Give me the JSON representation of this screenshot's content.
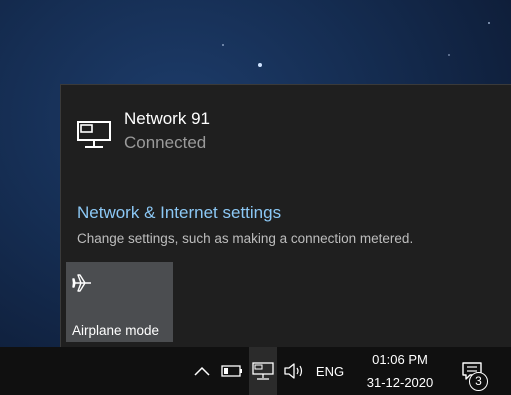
{
  "flyout": {
    "network": {
      "name": "Network 91",
      "status": "Connected",
      "icon": "ethernet-monitor-icon"
    },
    "settings_link": "Network & Internet settings",
    "settings_description": "Change settings, such as making a connection metered.",
    "quick_actions": [
      {
        "label": "Airplane mode",
        "icon": "airplane-icon",
        "state": "off"
      }
    ]
  },
  "taskbar": {
    "tray_icons": [
      "chevron-up-icon",
      "battery-icon",
      "network-icon",
      "volume-icon"
    ],
    "language": "ENG",
    "time": "01:06 PM",
    "date": "31-12-2020",
    "notification_count": "3"
  },
  "colors": {
    "flyout_bg": "#1f1f1f",
    "link": "#8cc8f5",
    "tile_bg": "#4b4d50",
    "taskbar_bg": "#101010"
  }
}
